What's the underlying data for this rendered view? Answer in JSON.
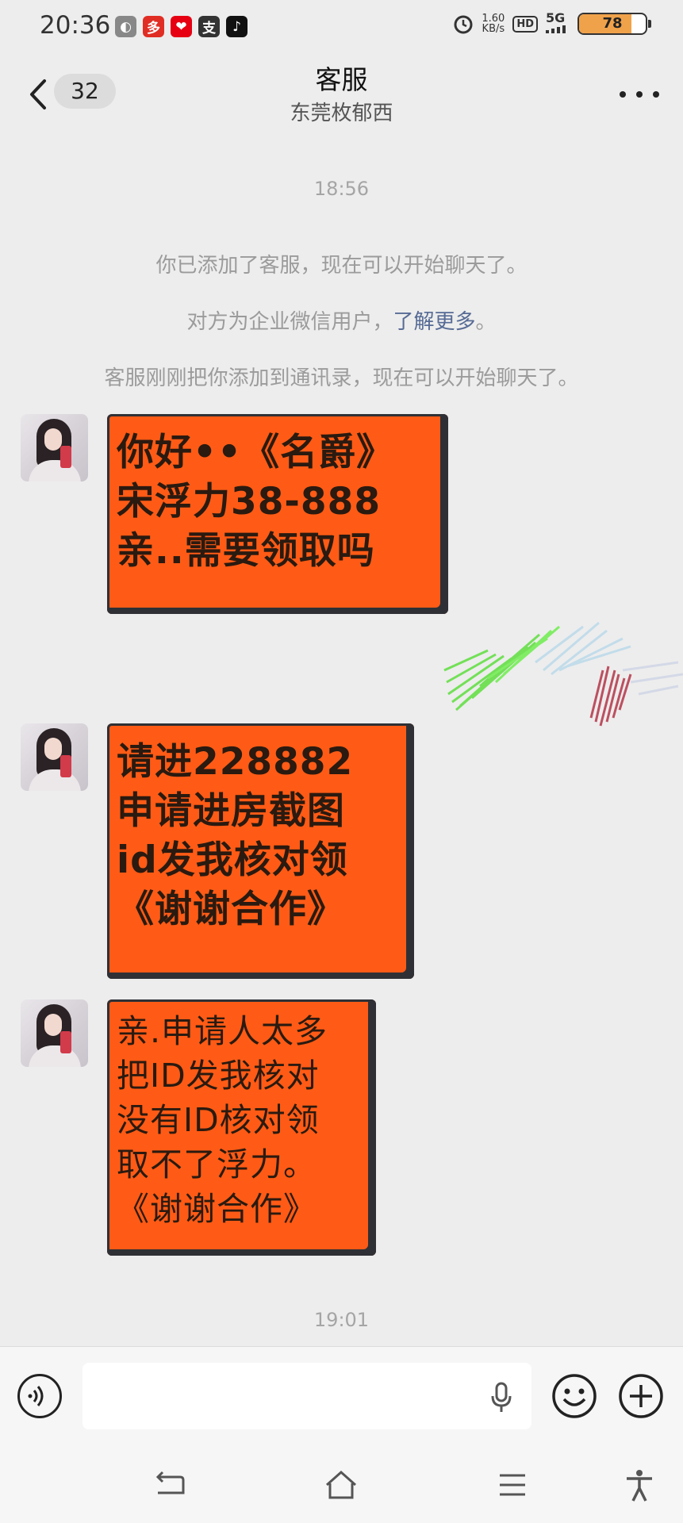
{
  "status_bar": {
    "time": "20:36",
    "app_icons": [
      {
        "name": "app-icon-1",
        "color": "#888888",
        "glyph": "◐"
      },
      {
        "name": "pinduoduo-icon",
        "color": "#e02e24",
        "glyph": "多"
      },
      {
        "name": "app-icon-red",
        "color": "#e60012",
        "glyph": "❤"
      },
      {
        "name": "alipay-icon",
        "color": "#333333",
        "glyph": "支"
      },
      {
        "name": "tiktok-icon",
        "color": "#111111",
        "glyph": "♪"
      }
    ],
    "net_rate_value": "1.60",
    "net_rate_unit": "KB/s",
    "hd_label": "HD",
    "network": "5G",
    "battery": "78",
    "battery_level": 0.78
  },
  "header": {
    "unread_count": "32",
    "title": "客服",
    "subtitle": "东莞枚郁西"
  },
  "messages": {
    "time_1": "18:56",
    "system_1": "你已添加了客服，现在可以开始聊天了。",
    "system_2_prefix": "对方为企业微信用户，",
    "system_2_link": "了解更多",
    "system_2_suffix": "。",
    "system_3": "客服刚刚把你添加到通讯录，现在可以开始聊天了。",
    "bubble_1": [
      "你好••《名爵》",
      "宋浮力38-888",
      "亲..需要领取吗"
    ],
    "bubble_2": [
      "请进228882",
      "申请进房截图",
      "id发我核对领",
      "《谢谢合作》"
    ],
    "bubble_3": [
      "亲.申请人太多",
      "把ID发我核对",
      "没有ID核对领",
      "取不了浮力。",
      "《谢谢合作》"
    ],
    "time_2": "19:01"
  },
  "colors": {
    "bubble": "#ff5b16",
    "link": "#576b95",
    "background": "#ededed"
  }
}
